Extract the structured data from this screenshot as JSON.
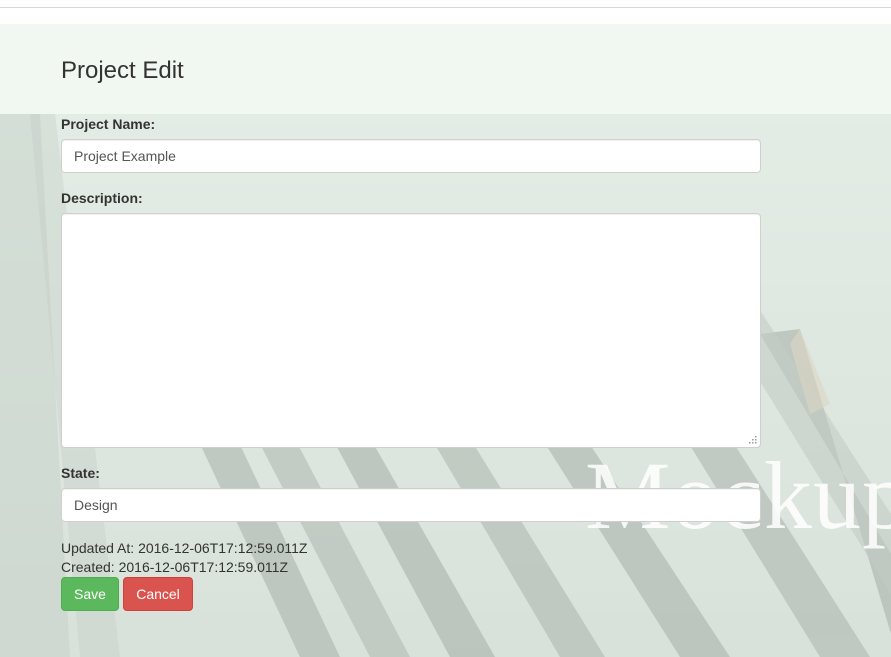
{
  "page": {
    "title": "Project Edit"
  },
  "form": {
    "name_label": "Project Name:",
    "name_value": "Project Example",
    "description_label": "Description:",
    "description_value": "",
    "state_label": "State:",
    "state_value": "Design"
  },
  "meta": {
    "updated_label": "Updated At:",
    "updated_value": "2016-12-06T17:12:59.011Z",
    "created_label": "Created:",
    "created_value": "2016-12-06T17:12:59.011Z"
  },
  "actions": {
    "save_label": "Save",
    "cancel_label": "Cancel"
  },
  "background": {
    "watermark_text": "Mockup"
  },
  "colors": {
    "save": "#5cb85c",
    "cancel": "#d9534f",
    "header_band": "#f1f8f1"
  }
}
